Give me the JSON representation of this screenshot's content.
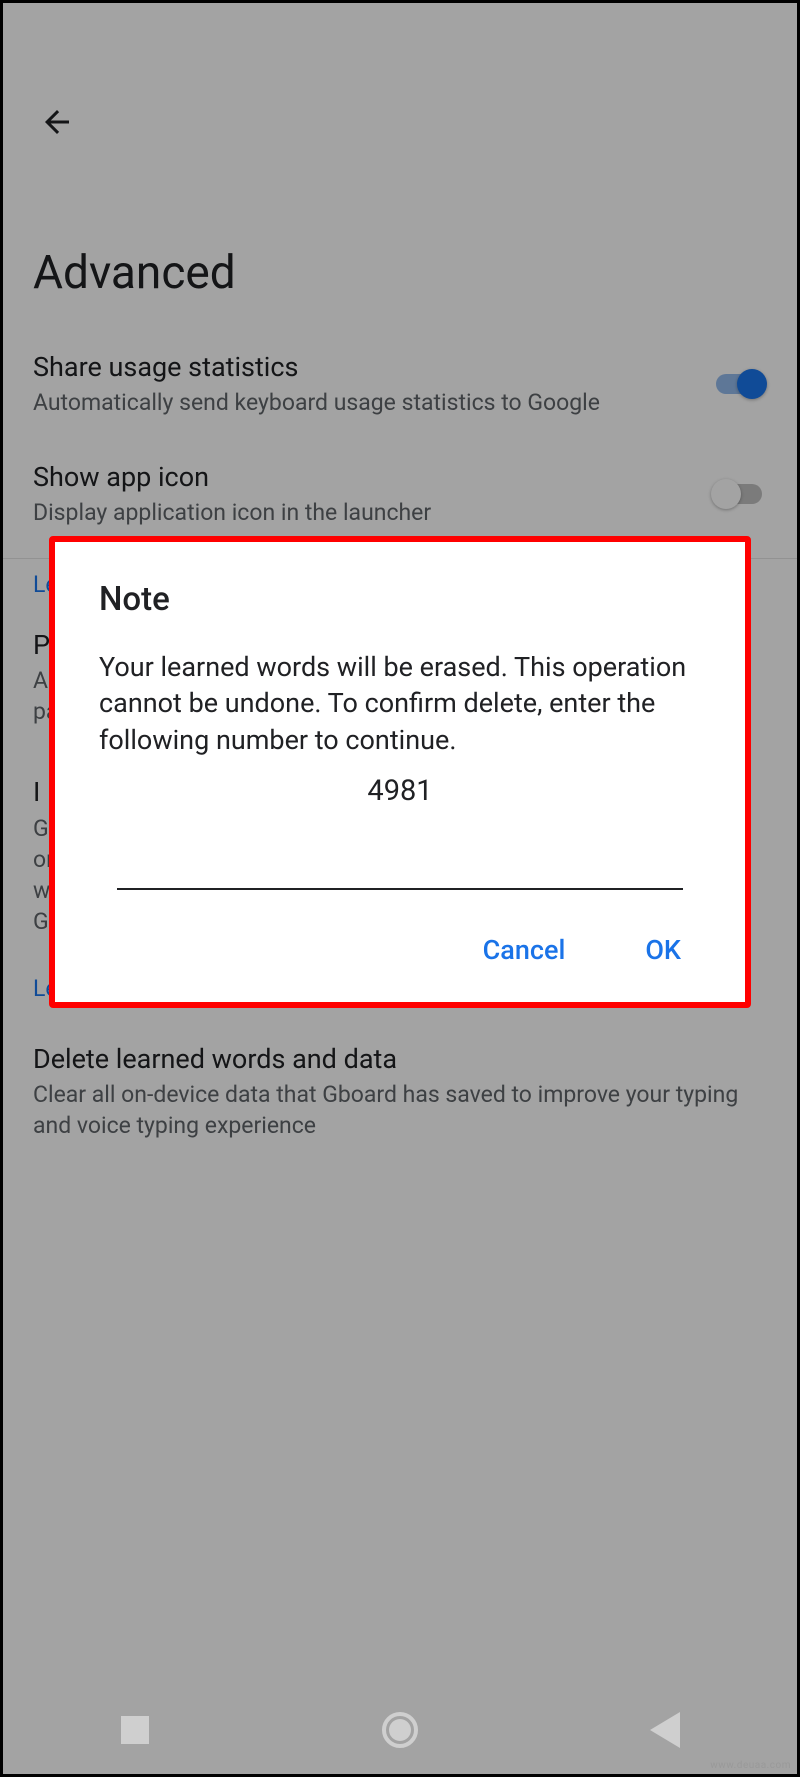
{
  "header": {
    "title": "Advanced"
  },
  "settings": {
    "share_stats": {
      "title": "Share usage statistics",
      "desc": "Automatically send keyboard usage statistics to Google",
      "on": true
    },
    "show_icon": {
      "title": "Show app icon",
      "desc": "Display application icon in the launcher",
      "on": false
    },
    "learn_more_1": "Le",
    "personalization": {
      "title": "P",
      "desc_line1": "A",
      "desc_line2": "pa"
    },
    "improve": {
      "title": "I",
      "desc_line1": "Gl",
      "desc_line2": "or",
      "desc_line3": "w",
      "desc_line4": "G"
    },
    "learn_more_2": "Le",
    "delete_data": {
      "title": "Delete learned words and data",
      "desc": "Clear all on-device data that Gboard has saved to improve your typing and voice typing experience"
    }
  },
  "dialog": {
    "title": "Note",
    "body": "Your learned words will be erased. This operation cannot be undone. To confirm delete, enter the following number to continue.",
    "number": "4981",
    "cancel": "Cancel",
    "ok": "OK"
  },
  "watermark": "www.deuaa.com"
}
